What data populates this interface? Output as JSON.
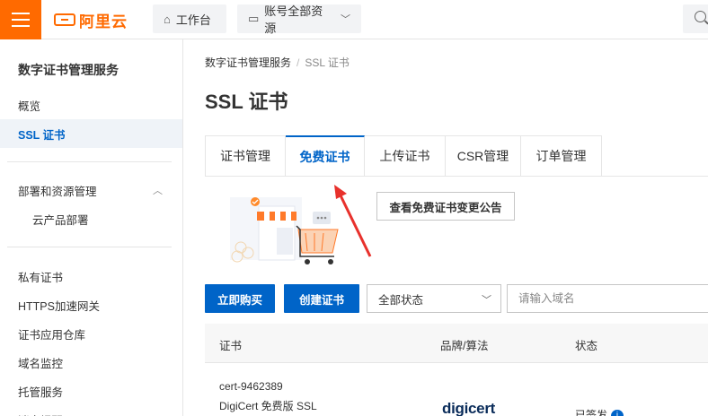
{
  "topbar": {
    "logo_text": "阿里云",
    "workbench": "工作台",
    "account_resources": "账号全部资源"
  },
  "sidebar": {
    "title": "数字证书管理服务",
    "items": [
      {
        "label": "概览"
      },
      {
        "label": "SSL 证书"
      },
      {
        "label": "部署和资源管理"
      },
      {
        "label": "云产品部署"
      },
      {
        "label": "私有证书"
      },
      {
        "label": "HTTPS加速网关"
      },
      {
        "label": "证书应用仓库"
      },
      {
        "label": "域名监控"
      },
      {
        "label": "托管服务"
      },
      {
        "label": "消息提醒"
      }
    ]
  },
  "breadcrumb": {
    "root": "数字证书管理服务",
    "sep": "/",
    "current": "SSL 证书"
  },
  "page_title": "SSL 证书",
  "tabs": [
    {
      "label": "证书管理"
    },
    {
      "label": "免费证书"
    },
    {
      "label": "上传证书"
    },
    {
      "label": "CSR管理"
    },
    {
      "label": "订单管理"
    }
  ],
  "notice_button": "查看免费证书变更公告",
  "toolbar": {
    "buy_label": "立即购买",
    "create_label": "创建证书",
    "status_value": "全部状态",
    "domain_placeholder": "请输入域名"
  },
  "table": {
    "columns": [
      "证书",
      "品牌/算法",
      "状态"
    ],
    "rows": [
      {
        "cert_id": "cert-9462389",
        "cert_name": "DigiCert 免费版 SSL",
        "brand": "digicert",
        "status": "已签发"
      }
    ]
  },
  "colors": {
    "accent": "#ff6a00",
    "primary": "#0064c8"
  }
}
